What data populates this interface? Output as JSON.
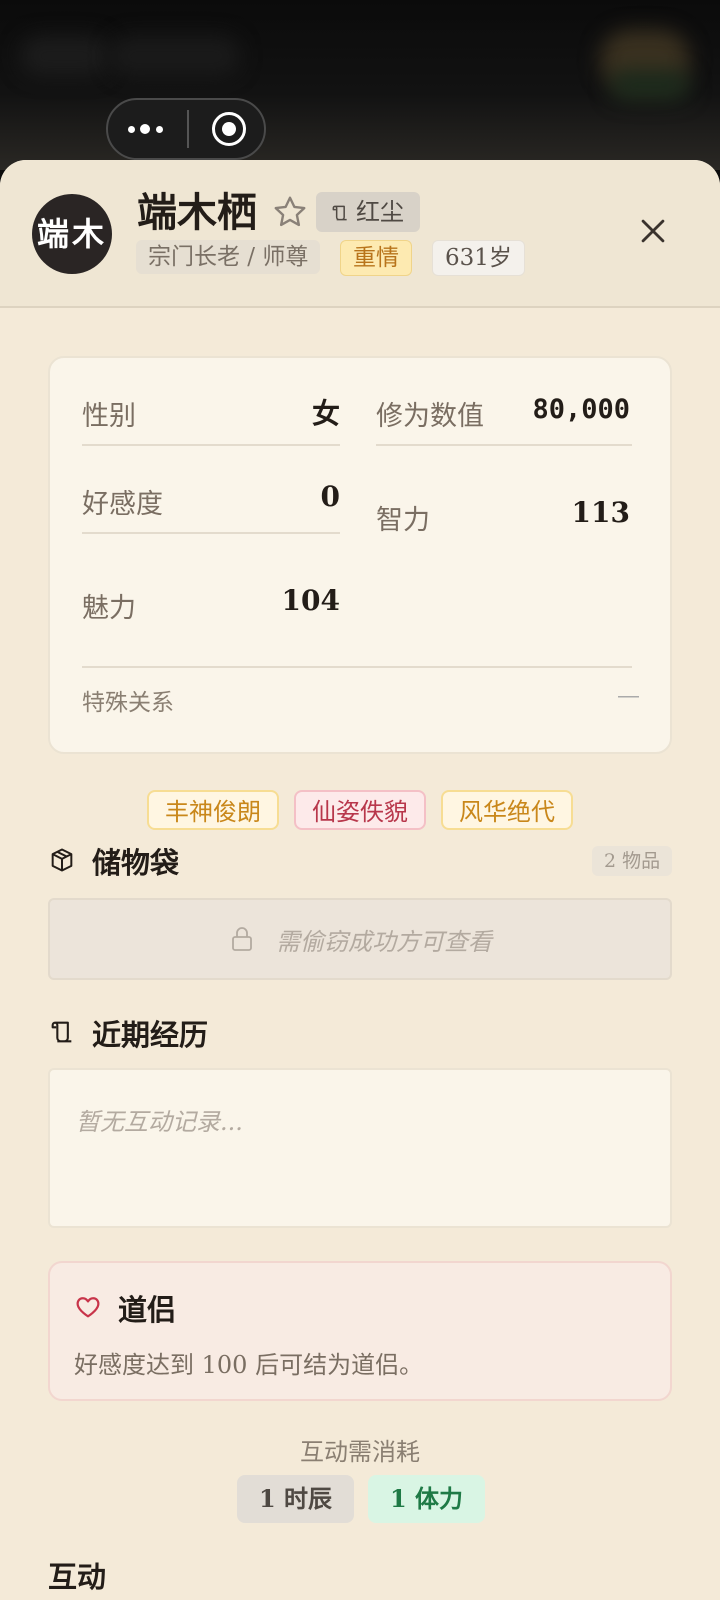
{
  "capsule": {
    "menu_icon": "more-dots-icon",
    "record_icon": "record-icon"
  },
  "profile": {
    "avatar_text": "端木",
    "name": "端木栖",
    "mood_tag": "红尘",
    "role": "宗门长老 / 师尊",
    "trait": "重情",
    "age": "631岁"
  },
  "stats": {
    "gender_label": "性别",
    "gender_value": "女",
    "cultivation_label": "修为数值",
    "cultivation_value": "80,000",
    "favor_label": "好感度",
    "favor_value": "0",
    "intellect_label": "智力",
    "intellect_value": "113",
    "charm_label": "魅力",
    "charm_value": "104",
    "relation_label": "特殊关系",
    "relation_value": "—"
  },
  "tags": [
    "丰神俊朗",
    "仙姿佚貌",
    "风华绝代"
  ],
  "storage": {
    "title": "储物袋",
    "count": "2 物品",
    "locked_text": "需偷窃成功方可查看"
  },
  "history": {
    "title": "近期经历",
    "empty_text": "暂无互动记录..."
  },
  "dao": {
    "title": "道侣",
    "desc": "好感度达到 100 后可结为道侣。"
  },
  "cost": {
    "label": "互动需消耗",
    "time": "1 时辰",
    "stamina": "1 体力"
  },
  "interact": {
    "title": "互动"
  },
  "colors": {
    "accent_gold": "#c9871a",
    "accent_red": "#b8374b",
    "accent_green": "#1f7a46",
    "sheet_bg": "#f4ead8"
  }
}
